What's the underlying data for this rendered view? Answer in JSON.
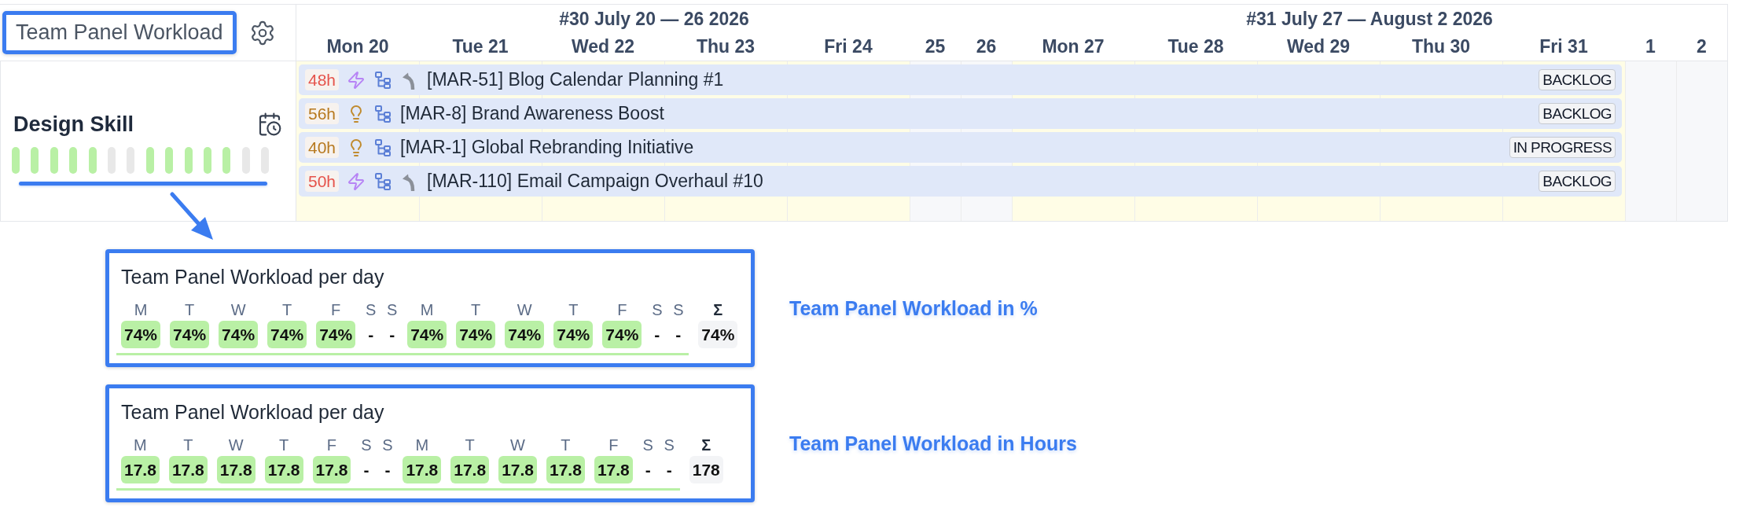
{
  "header": {
    "title": "Team Panel Workload"
  },
  "weeks": [
    {
      "title": "#30 July 20 — 26 2026",
      "days": [
        {
          "label": "Mon 20",
          "weekend": false
        },
        {
          "label": "Tue 21",
          "weekend": false
        },
        {
          "label": "Wed 22",
          "weekend": false
        },
        {
          "label": "Thu 23",
          "weekend": false
        },
        {
          "label": "Fri 24",
          "weekend": false
        },
        {
          "label": "25",
          "weekend": true
        },
        {
          "label": "26",
          "weekend": true
        }
      ]
    },
    {
      "title": "#31 July 27 — August 2 2026",
      "days": [
        {
          "label": "Mon 27",
          "weekend": false
        },
        {
          "label": "Tue 28",
          "weekend": false
        },
        {
          "label": "Wed 29",
          "weekend": false
        },
        {
          "label": "Thu 30",
          "weekend": false
        },
        {
          "label": "Fri 31",
          "weekend": false
        },
        {
          "label": "1",
          "weekend": true
        },
        {
          "label": "2",
          "weekend": true
        }
      ]
    }
  ],
  "lane": {
    "title": "Design Skill",
    "capacity_bars": [
      {
        "color": "#b9f0a5"
      },
      {
        "color": "#b9f0a5"
      },
      {
        "color": "#b9f0a5"
      },
      {
        "color": "#b9f0a5"
      },
      {
        "color": "#b9f0a5"
      },
      {
        "color": "#e8e8e8"
      },
      {
        "color": "#e8e8e8"
      },
      {
        "color": "#b9f0a5"
      },
      {
        "color": "#b9f0a5"
      },
      {
        "color": "#b9f0a5"
      },
      {
        "color": "#b9f0a5"
      },
      {
        "color": "#b9f0a5"
      },
      {
        "color": "#e8e8e8"
      },
      {
        "color": "#e8e8e8"
      }
    ]
  },
  "tasks": [
    {
      "estimate": {
        "text": "48h",
        "color": "#e5534b"
      },
      "kind": "bolt",
      "curved_arrow": true,
      "title": "[MAR-51] Blog Calendar Planning #1",
      "status": "BACKLOG"
    },
    {
      "estimate": {
        "text": "56h",
        "color": "#b7791f"
      },
      "kind": "bulb",
      "curved_arrow": false,
      "title": "[MAR-8] Brand Awareness Boost",
      "status": "BACKLOG"
    },
    {
      "estimate": {
        "text": "40h",
        "color": "#b7791f"
      },
      "kind": "bulb",
      "curved_arrow": false,
      "title": "[MAR-1] Global Rebranding Initiative",
      "status": "IN PROGRESS"
    },
    {
      "estimate": {
        "text": "50h",
        "color": "#e5534b"
      },
      "kind": "bolt",
      "curved_arrow": true,
      "title": "[MAR-110] Email Campaign Overhaul #10",
      "status": "BACKLOG"
    }
  ],
  "workload_cards": [
    {
      "title": "Team Panel Workload per day",
      "days": [
        {
          "letter": "M",
          "value": "74%",
          "kind": "workday"
        },
        {
          "letter": "T",
          "value": "74%",
          "kind": "workday"
        },
        {
          "letter": "W",
          "value": "74%",
          "kind": "workday"
        },
        {
          "letter": "T",
          "value": "74%",
          "kind": "workday"
        },
        {
          "letter": "F",
          "value": "74%",
          "kind": "workday"
        },
        {
          "letter": "S",
          "value": "-",
          "kind": "weekend"
        },
        {
          "letter": "S",
          "value": "-",
          "kind": "weekend"
        },
        {
          "letter": "M",
          "value": "74%",
          "kind": "workday"
        },
        {
          "letter": "T",
          "value": "74%",
          "kind": "workday"
        },
        {
          "letter": "W",
          "value": "74%",
          "kind": "workday"
        },
        {
          "letter": "T",
          "value": "74%",
          "kind": "workday"
        },
        {
          "letter": "F",
          "value": "74%",
          "kind": "workday"
        },
        {
          "letter": "S",
          "value": "-",
          "kind": "weekend"
        },
        {
          "letter": "S",
          "value": "-",
          "kind": "weekend"
        }
      ],
      "total": {
        "label": "Σ",
        "value": "74%"
      },
      "caption": "Team Panel Workload in %"
    },
    {
      "title": "Team Panel Workload per day",
      "days": [
        {
          "letter": "M",
          "value": "17.8",
          "kind": "workday"
        },
        {
          "letter": "T",
          "value": "17.8",
          "kind": "workday"
        },
        {
          "letter": "W",
          "value": "17.8",
          "kind": "workday"
        },
        {
          "letter": "T",
          "value": "17.8",
          "kind": "workday"
        },
        {
          "letter": "F",
          "value": "17.8",
          "kind": "workday"
        },
        {
          "letter": "S",
          "value": "-",
          "kind": "weekend"
        },
        {
          "letter": "S",
          "value": "-",
          "kind": "weekend"
        },
        {
          "letter": "M",
          "value": "17.8",
          "kind": "workday"
        },
        {
          "letter": "T",
          "value": "17.8",
          "kind": "workday"
        },
        {
          "letter": "W",
          "value": "17.8",
          "kind": "workday"
        },
        {
          "letter": "T",
          "value": "17.8",
          "kind": "workday"
        },
        {
          "letter": "F",
          "value": "17.8",
          "kind": "workday"
        },
        {
          "letter": "S",
          "value": "-",
          "kind": "weekend"
        },
        {
          "letter": "S",
          "value": "-",
          "kind": "weekend"
        }
      ],
      "total": {
        "label": "Σ",
        "value": "178"
      },
      "caption": "Team Panel Workload in Hours"
    }
  ]
}
